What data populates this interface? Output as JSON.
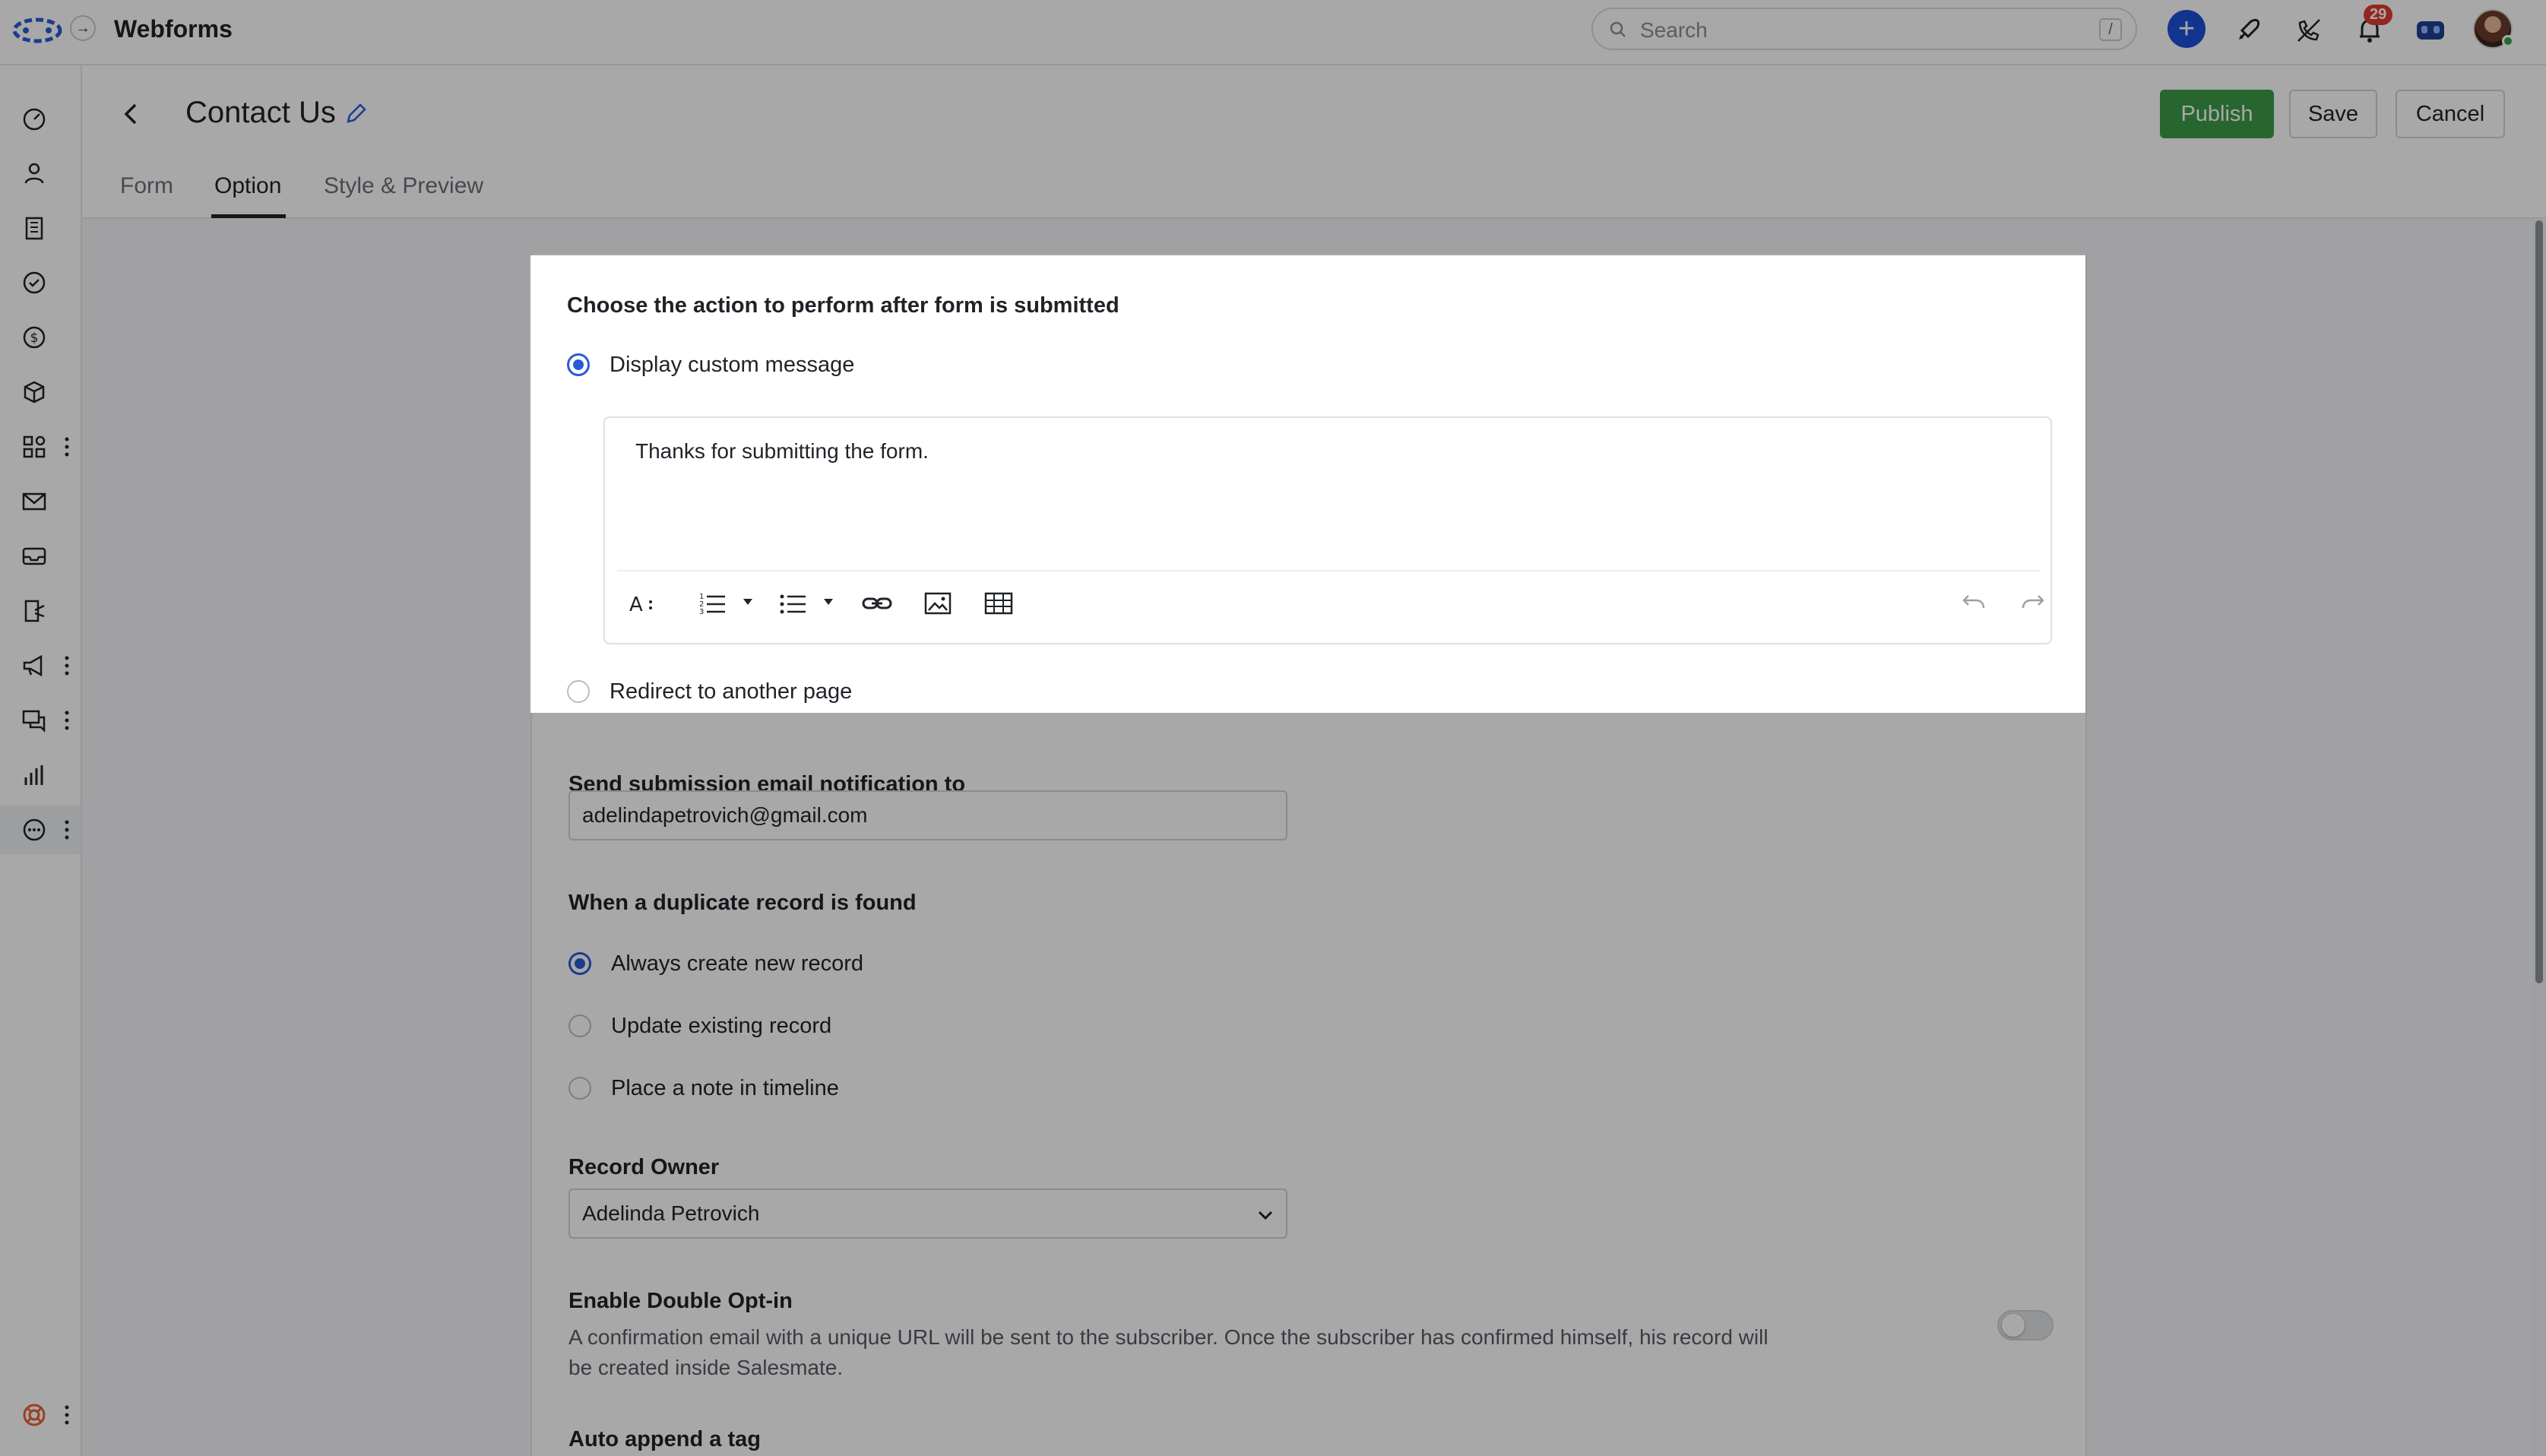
{
  "app": {
    "title": "Webforms",
    "search_placeholder": "Search",
    "search_shortcut": "/",
    "notification_count": "29"
  },
  "topbar_icons": [
    "plus-icon",
    "rocket-icon",
    "phone-off-icon",
    "bell-icon",
    "bot-icon",
    "avatar"
  ],
  "sidebar": {
    "items": [
      {
        "name": "dashboard-icon",
        "menu": false
      },
      {
        "name": "contacts-icon",
        "menu": false
      },
      {
        "name": "companies-icon",
        "menu": false
      },
      {
        "name": "tasks-icon",
        "menu": false
      },
      {
        "name": "deals-icon",
        "menu": false
      },
      {
        "name": "products-icon",
        "menu": false
      },
      {
        "name": "apps-icon",
        "menu": true
      },
      {
        "name": "email-icon",
        "menu": false
      },
      {
        "name": "inbox-icon",
        "menu": false
      },
      {
        "name": "sequences-icon",
        "menu": false
      },
      {
        "name": "campaigns-icon",
        "menu": true
      },
      {
        "name": "chat-icon",
        "menu": true
      },
      {
        "name": "reports-icon",
        "menu": false
      },
      {
        "name": "more-icon",
        "menu": true,
        "active": true
      }
    ],
    "help_icon": "lifebuoy-icon"
  },
  "header": {
    "title": "Contact Us",
    "publish_label": "Publish",
    "save_label": "Save",
    "cancel_label": "Cancel",
    "tabs": [
      {
        "label": "Form"
      },
      {
        "label": "Option",
        "active": true
      },
      {
        "label": "Style & Preview"
      }
    ]
  },
  "submit_action": {
    "heading": "Choose the action to perform after form is submitted",
    "option_message": "Display custom message",
    "message_text": "Thanks for submitting the form.",
    "option_redirect": "Redirect to another page",
    "selected": "Display custom message"
  },
  "notification": {
    "label": "Send submission email notification to",
    "value": "adelindapetrovich@gmail.com"
  },
  "duplicate": {
    "heading": "When a duplicate record is found",
    "options": [
      "Always create new record",
      "Update existing record",
      "Place a note in timeline"
    ],
    "selected": "Always create new record"
  },
  "record_owner": {
    "label": "Record Owner",
    "value": "Adelinda Petrovich"
  },
  "double_opt_in": {
    "heading": "Enable Double Opt-in",
    "description": "A confirmation email with a unique URL will be sent to the subscriber. Once the subscriber has confirmed himself, his record will be created inside Salesmate.",
    "enabled": false
  },
  "auto_tag": {
    "heading": "Auto append a tag"
  },
  "colors": {
    "primary": "#2a5bd7",
    "publish": "#3c9c48",
    "badge": "#e03c2e"
  }
}
